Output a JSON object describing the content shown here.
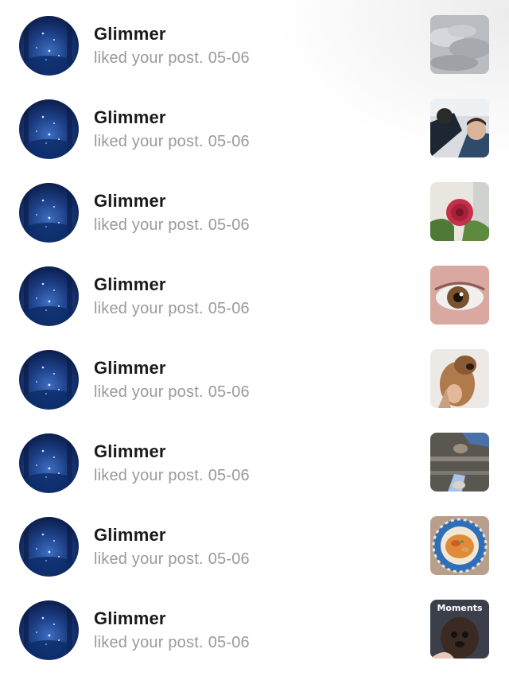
{
  "notifications": [
    {
      "user": "Glimmer",
      "action": "liked your post.",
      "date": "05-06",
      "thumbnail": "gray-cloudy-photo"
    },
    {
      "user": "Glimmer",
      "action": "liked your post.",
      "date": "05-06",
      "thumbnail": "man-car-photo"
    },
    {
      "user": "Glimmer",
      "action": "liked your post.",
      "date": "05-06",
      "thumbnail": "red-flower-photo"
    },
    {
      "user": "Glimmer",
      "action": "liked your post.",
      "date": "05-06",
      "thumbnail": "eye-closeup-photo"
    },
    {
      "user": "Glimmer",
      "action": "liked your post.",
      "date": "05-06",
      "thumbnail": "puppy-photo"
    },
    {
      "user": "Glimmer",
      "action": "liked your post.",
      "date": "05-06",
      "thumbnail": "shoes-floor-photo"
    },
    {
      "user": "Glimmer",
      "action": "liked your post.",
      "date": "05-06",
      "thumbnail": "pasta-plate-photo"
    },
    {
      "user": "Glimmer",
      "action": "liked your post.",
      "date": "05-06",
      "thumbnail": "dog-moments-photo",
      "thumbnail_caption": "Moments"
    }
  ]
}
